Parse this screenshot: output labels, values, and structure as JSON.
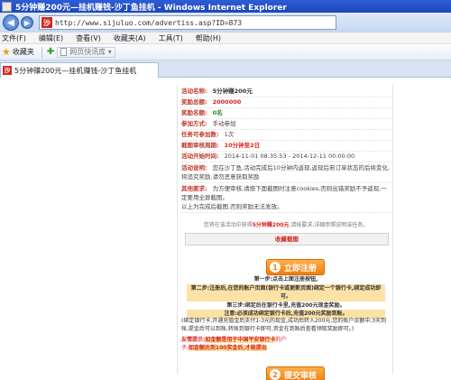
{
  "window": {
    "title": "5分钟赚200元—挂机赚钱-沙丁鱼挂机 - Windows Internet Explorer"
  },
  "address": {
    "url": "http://www.sijuluo.com/advertiss.asp?ID=873"
  },
  "menu": [
    "文件(F)",
    "编辑(E)",
    "查看(V)",
    "收藏夹(A)",
    "工具(T)",
    "帮助(H)"
  ],
  "favorites": {
    "label": "收藏夹",
    "suggest": "网页快讯库 ▾"
  },
  "tab": {
    "label": "5分钟赚200元—挂机赚钱-沙丁鱼挂机"
  },
  "info": {
    "activity_key": "活动名称:",
    "activity_val": "5分钟赚200元",
    "total_key": "奖励总额:",
    "total_val": "2000000",
    "quota_key": "奖励名额:",
    "quota_val": "0名",
    "method_key": "参加方式:",
    "method_val": "手动参加",
    "times_key": "任务可参加数:",
    "times_val": "1次",
    "review_key": "截图审核周期:",
    "review_val": "10分钟至2日",
    "period_key": "活动开始时间:",
    "period_val": "2014-11-01 08:35:53 - 2014-12-11 00:00:00",
    "desc_key": "活动说明:",
    "desc_val": "您在沙丁鱼,活动完成后10分钟内返现,返现后若订单状态的后续变化,将追究奖励,请勿恶意获取奖励",
    "other_key": "其他要求:",
    "other_val": "为方便审核,请按下面截图时注意cookies,否则出错奖励不予返现,一定要用全屏截图。",
    "other_val2": "以上为完成后截图,否则奖励无法发放。"
  },
  "collect": "收藏截图",
  "notice_prefix": "您将在该活动中获得",
  "notice_bold": "5分钟赚200元",
  "notice_suffix": ",请按要求,详细参照说明该任务。",
  "register_button": {
    "num": "1",
    "label": "立即注册"
  },
  "steps": {
    "s1": "第一步:点击上面注册按钮,",
    "s2": "第二步:注册后,在您的账户页面(银行卡或更新页面)绑定一个银行卡,绑定成功即可。",
    "s3": "第三步:绑定后在银行卡里,充值200元现金奖励。",
    "s4": "注意:必须成功绑定银行卡后,充值200元奖励到账。"
  },
  "remark": "(绑定银行卡,开通充值金后支付1-3元的现金,成功后转入200元,您的账户余额中,3天到账,提金后可以到账,转账到银行卡即可,资金在到账后查看领取奖励即可。)",
  "warn": {
    "prefix": "友情提示:",
    "hl": "如金额是用于中国平安银行卡",
    "mid": "的户",
    "line2a": "子,",
    "line2b": "如金额达到100奖金后,才能提出"
  },
  "submit_button": {
    "num": "2",
    "label": "提交审核"
  }
}
